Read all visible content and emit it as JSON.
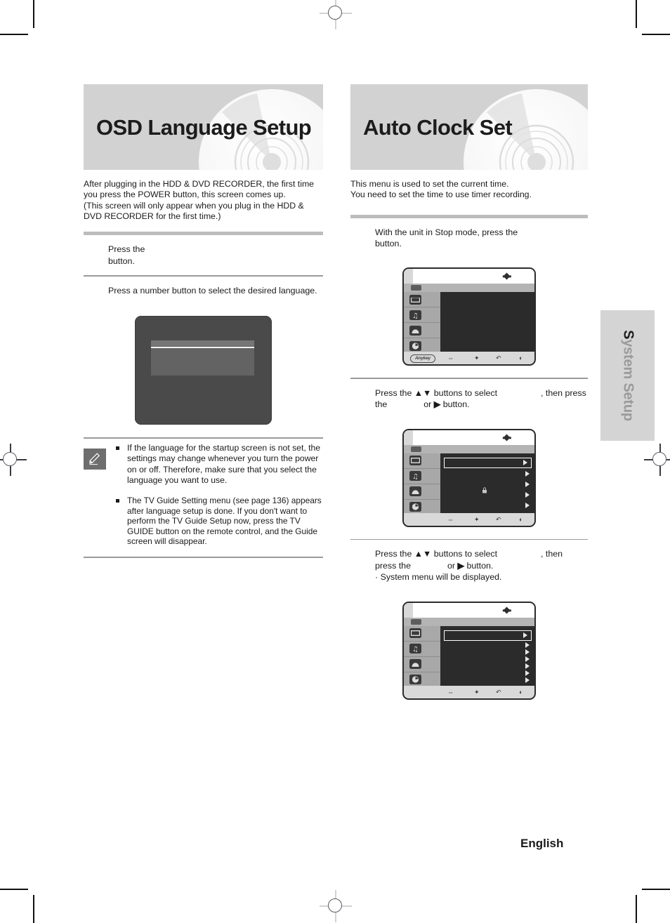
{
  "document": {
    "footer_language": "English",
    "side_tab": {
      "first_letter": "S",
      "rest": "ystem Setup"
    }
  },
  "left_column": {
    "banner_title": "OSD Language Setup",
    "intro": "After plugging in the HDD & DVD RECORDER, the first time you press the POWER button, this screen comes up.\n(This screen will only appear when you plug in the HDD & DVD RECORDER for the first time.)",
    "steps": [
      {
        "number": "",
        "text_before": "Press the",
        "text_after": "button."
      },
      {
        "number": "",
        "text": "Press a number button to select the desired language."
      }
    ],
    "screenshot": {
      "name": "startup-language-screen"
    },
    "notes": [
      "If the language for the startup screen is not set, the settings may change whenever you turn the power on or off. Therefore, make sure that you select the language you want to use.",
      "The TV Guide Setting menu (see page 136) appears after language setup is done. If you don't want to perform the TV Guide Setup now, press the TV GUIDE button on the remote control, and the Guide screen will disappear."
    ]
  },
  "right_column": {
    "banner_title": "Auto Clock Set",
    "intro": "This menu is used to set the current time.\nYou need to set the time to use timer recording.",
    "steps": [
      {
        "number": "",
        "line1_before": "With the unit in Stop mode, press the",
        "line2": "button."
      },
      {
        "number": "",
        "line1_before": "Press the",
        "line1_arrows": "▲▼",
        "line1_mid": "buttons to select",
        "line1_after": ", then press",
        "line2_before": "the",
        "line2_mid": "or",
        "line2_arrow": "▶",
        "line2_after": "button."
      },
      {
        "number": "",
        "line1_before": "Press the",
        "line1_arrows": "▲▼",
        "line1_mid": "buttons to select",
        "line1_after": ", then",
        "line2_before": "press the",
        "line2_mid": "or",
        "line2_arrow": "▶",
        "line2_after": "button.",
        "bullet": "· System menu will be displayed."
      }
    ],
    "osd_screens": [
      {
        "name": "main-menu-screen",
        "sidebar_icons": [
          "filmstrip-icon",
          "music-note-icon",
          "parental-rating-icon",
          "clock-icon",
          "gear-setup-icon"
        ],
        "active_index": -1,
        "rows": 0,
        "footer_anykey": "Anykey",
        "footer_icons": [
          "move-icon",
          "select-icon",
          "return-icon",
          "exit-icon"
        ],
        "show_anykey": true
      },
      {
        "name": "setup-menu-screen",
        "sidebar_icons": [
          "filmstrip-icon",
          "music-note-icon",
          "parental-rating-icon",
          "clock-icon",
          "gear-setup-icon"
        ],
        "active_index": 4,
        "rows": 5,
        "selected_row": 0,
        "has_lock": true,
        "footer_icons": [
          "move-icon",
          "select-icon",
          "return-icon",
          "exit-icon"
        ],
        "show_anykey": false
      },
      {
        "name": "system-menu-screen",
        "sidebar_icons": [
          "filmstrip-icon",
          "music-note-icon",
          "parental-rating-icon",
          "clock-icon",
          "gear-setup-icon"
        ],
        "active_index": 4,
        "rows": 7,
        "selected_row": 0,
        "has_lock": false,
        "footer_icons": [
          "move-icon",
          "select-icon",
          "return-icon",
          "exit-icon"
        ],
        "show_anykey": false
      }
    ]
  }
}
